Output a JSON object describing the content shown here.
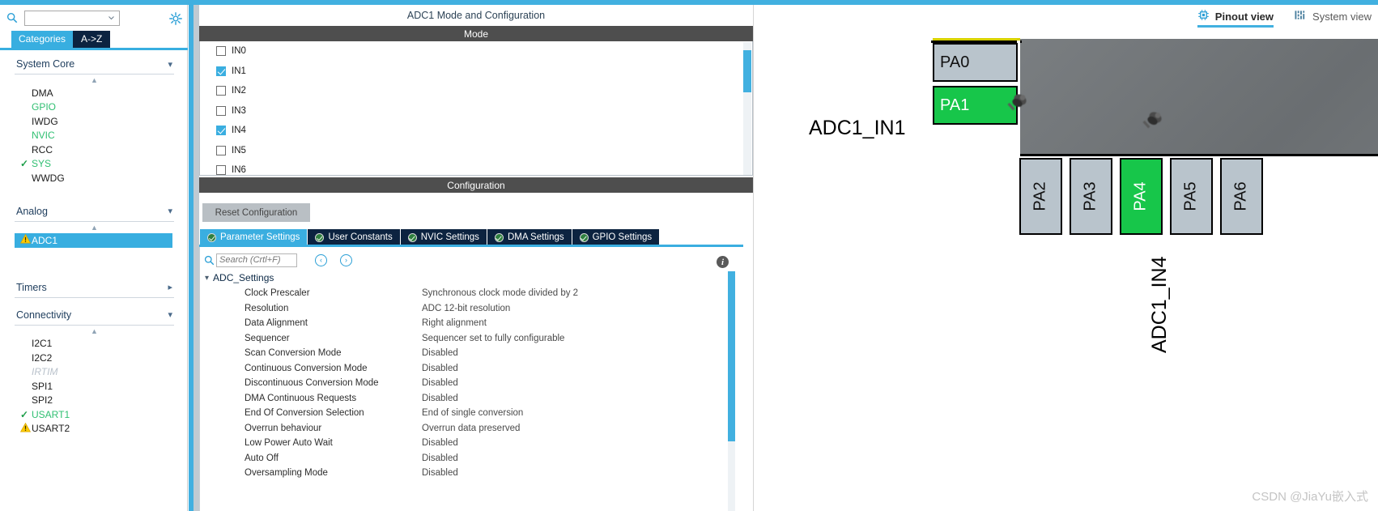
{
  "app": {
    "watermark": "CSDN @JiaYu嵌入式"
  },
  "sidebar": {
    "search": {
      "value": "",
      "placeholder": ""
    },
    "tabs": [
      {
        "label": "Categories",
        "active": true
      },
      {
        "label": "A->Z",
        "active": false
      }
    ],
    "groups": [
      {
        "title": "System Core",
        "expanded": true,
        "items": [
          {
            "label": "DMA",
            "state": "none"
          },
          {
            "label": "GPIO",
            "state": "configured"
          },
          {
            "label": "IWDG",
            "state": "none"
          },
          {
            "label": "NVIC",
            "state": "configured"
          },
          {
            "label": "RCC",
            "state": "none"
          },
          {
            "label": "SYS",
            "state": "ok"
          },
          {
            "label": "WWDG",
            "state": "none"
          }
        ]
      },
      {
        "title": "Analog",
        "expanded": true,
        "items": [
          {
            "label": "ADC1",
            "state": "warning",
            "selected": true
          }
        ]
      },
      {
        "title": "Timers",
        "expanded": false,
        "items": []
      },
      {
        "title": "Connectivity",
        "expanded": true,
        "items": [
          {
            "label": "I2C1",
            "state": "none"
          },
          {
            "label": "I2C2",
            "state": "none"
          },
          {
            "label": "IRTIM",
            "state": "disabled"
          },
          {
            "label": "SPI1",
            "state": "none"
          },
          {
            "label": "SPI2",
            "state": "none"
          },
          {
            "label": "USART1",
            "state": "ok"
          },
          {
            "label": "USART2",
            "state": "warning"
          }
        ]
      }
    ]
  },
  "middle": {
    "title": "ADC1 Mode and Configuration",
    "mode_bar": "Mode",
    "channels": [
      {
        "label": "IN0",
        "checked": false
      },
      {
        "label": "IN1",
        "checked": true
      },
      {
        "label": "IN2",
        "checked": false
      },
      {
        "label": "IN3",
        "checked": false
      },
      {
        "label": "IN4",
        "checked": true
      },
      {
        "label": "IN5",
        "checked": false
      },
      {
        "label": "IN6",
        "checked": false
      }
    ],
    "config_bar": "Configuration",
    "reset_label": "Reset Configuration",
    "config_tabs": [
      {
        "label": "Parameter Settings",
        "active": true
      },
      {
        "label": "User Constants",
        "active": false
      },
      {
        "label": "NVIC Settings",
        "active": false
      },
      {
        "label": "DMA Settings",
        "active": false
      },
      {
        "label": "GPIO Settings",
        "active": false
      }
    ],
    "param_search": {
      "value": "",
      "placeholder": "Search (Crtl+F)"
    },
    "nav_prev": "‹",
    "nav_next": "›",
    "tree_group": "ADC_Settings",
    "parameters": [
      {
        "key": "Clock Prescaler",
        "value": "Synchronous clock mode divided by 2"
      },
      {
        "key": "Resolution",
        "value": "ADC 12-bit resolution"
      },
      {
        "key": "Data Alignment",
        "value": "Right alignment"
      },
      {
        "key": "Sequencer",
        "value": "Sequencer set to fully configurable"
      },
      {
        "key": "Scan Conversion Mode",
        "value": "Disabled"
      },
      {
        "key": "Continuous Conversion Mode",
        "value": "Disabled"
      },
      {
        "key": "Discontinuous Conversion Mode",
        "value": "Disabled"
      },
      {
        "key": "DMA Continuous Requests",
        "value": "Disabled"
      },
      {
        "key": "End Of Conversion Selection",
        "value": "End of single conversion"
      },
      {
        "key": "Overrun behaviour",
        "value": "Overrun data preserved"
      },
      {
        "key": "Low Power Auto Wait",
        "value": "Disabled"
      },
      {
        "key": "Auto Off",
        "value": "Disabled"
      },
      {
        "key": "Oversampling Mode",
        "value": "Disabled"
      }
    ]
  },
  "right": {
    "view_tabs": [
      {
        "label": "Pinout view",
        "icon": "chip-icon",
        "active": true
      },
      {
        "label": "System view",
        "icon": "layers-icon",
        "active": false
      }
    ],
    "pins": [
      {
        "name": "PA0",
        "side": "left",
        "state": "default"
      },
      {
        "name": "PA1",
        "side": "left",
        "state": "assigned"
      },
      {
        "name": "PA2",
        "side": "bottom",
        "state": "default"
      },
      {
        "name": "PA3",
        "side": "bottom",
        "state": "default"
      },
      {
        "name": "PA4",
        "side": "bottom",
        "state": "assigned"
      },
      {
        "name": "PA5",
        "side": "bottom",
        "state": "default"
      },
      {
        "name": "PA6",
        "side": "bottom",
        "state": "default"
      }
    ],
    "signal_labels": [
      {
        "text": "ADC1_IN1",
        "pin": "PA1",
        "orientation": "horizontal"
      },
      {
        "text": "ADC1_IN4",
        "pin": "PA4",
        "orientation": "vertical"
      }
    ],
    "colors": {
      "assigned_pin": "#17c64a",
      "default_pin": "#b9c4cc",
      "accent": "#41b0e0",
      "dark_tab": "#0c2340"
    }
  }
}
